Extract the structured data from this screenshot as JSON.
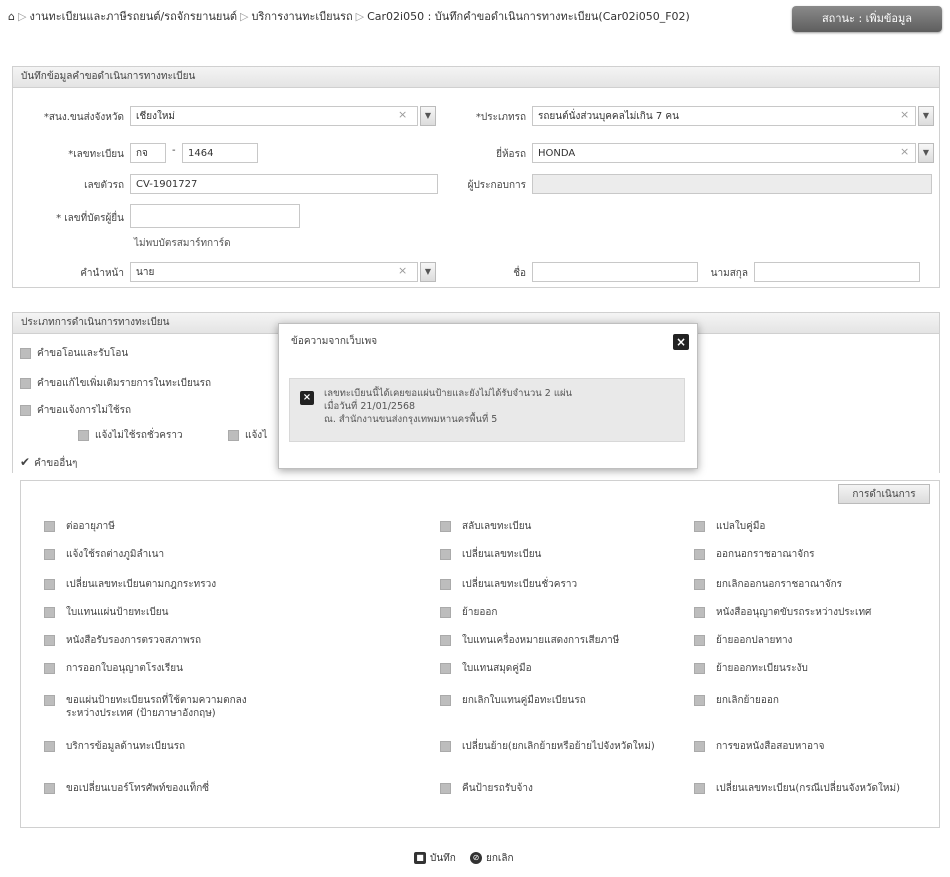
{
  "breadcrumb": {
    "items": [
      "งานทะเบียนและภาษีรถยนต์/รถจักรยานยนต์",
      "บริการงานทะเบียนรถ",
      "Car02i050 : บันทึกคำขอดำเนินการทางทะเบียน(Car02i050_F02)"
    ]
  },
  "status_label": "สถานะ : เพิ่มข้อมูล",
  "section1": {
    "title": "บันทึกข้อมูลคำขอดำเนินการทางทะเบียน",
    "province_label": "*สนง.ขนส่งจังหวัด",
    "province_value": "เชียงใหม่",
    "type_label": "*ประเภทรถ",
    "type_value": "รถยนต์นั่งส่วนบุคคลไม่เกิน 7 คน",
    "plate_label": "*เลขทะเบียน",
    "plate_prefix": "กจ",
    "plate_number": "1464",
    "brand_label": "ยี่ห้อรถ",
    "brand_value": "HONDA",
    "chassis_label": "เลขตัวรถ",
    "chassis_value": "CV-1901727",
    "operator_label": "ผู้ประกอบการ",
    "operator_value": "",
    "idcard_label": "* เลขที่บัตรผู้ยื่น",
    "idcard_value": "",
    "idcard_note": "ไม่พบบัตรสมาร์ทการ์ด",
    "title_label": "คำนำหน้า",
    "title_value": "นาย",
    "name_label": "ชื่อ",
    "name_value": "",
    "surname_label": "นามสกุล",
    "surname_value": ""
  },
  "section2": {
    "title": "ประเภทการดำเนินการทางทะเบียน",
    "options": [
      {
        "label": "คำขอโอนและรับโอน",
        "checked": false
      },
      {
        "label": "คำขอแก้ไขเพิ่มเติมรายการในทะเบียนรถ",
        "checked": false
      },
      {
        "label": "คำขอแจ้งการไม่ใช้รถ",
        "checked": false
      }
    ],
    "suboptions": [
      "แจ้งไม่ใช้รถชั่วคราว",
      "แจ้งไ"
    ],
    "other_label": "คำขออื่นๆ",
    "other_checked": true
  },
  "modal": {
    "title": "ข้อความจากเว็บเพจ",
    "message_lines": [
      "เลขทะเบียนนี้ได้เคยขอแผ่นป้ายและยังไม่ได้รับจำนวน 2 แผ่น",
      "เมื่อวันที่ 21/01/2568",
      "ณ. สำนักงานขนส่งกรุงเทพมหานครพื้นที่ 5"
    ]
  },
  "actions_button": "การดำเนินการ",
  "grid": [
    [
      "ต่ออายุภาษี",
      "สลับเลขทะเบียน",
      "แปลใบคู่มือ"
    ],
    [
      "แจ้งใช้รถต่างภูมิลำเนา",
      "เปลี่ยนเลขทะเบียน",
      "ออกนอกราชอาณาจักร"
    ],
    [
      "เปลี่ยนเลขทะเบียนตามกฎกระทรวง",
      "เปลี่ยนเลขทะเบียนชั่วคราว",
      "ยกเลิกออกนอกราชอาณาจักร"
    ],
    [
      "ใบแทนแผ่นป้ายทะเบียน",
      "ย้ายออก",
      "หนังสืออนุญาตขับรถระหว่างประเทศ"
    ],
    [
      "หนังสือรับรองการตรวจสภาพรถ",
      "ใบแทนเครื่องหมายแสดงการเสียภาษี",
      "ย้ายออกปลายทาง"
    ],
    [
      "การออกใบอนุญาตโรงเรียน",
      "ใบแทนสมุดคู่มือ",
      "ย้ายออกทะเบียนระงับ"
    ],
    [
      "ขอแผ่นป้ายทะเบียนรถที่ใช้ตามความตกลงระหว่างประเทศ (ป้ายภาษาอังกฤษ)",
      "ยกเลิกใบแทนคู่มือทะเบียนรถ",
      "ยกเลิกย้ายออก"
    ],
    [
      "บริการข้อมูลด้านทะเบียนรถ",
      "เปลี่ยนย้าย(ยกเลิกย้ายหรือย้ายไปจังหวัดใหม่)",
      "การขอหนังสือสอบหาอาจ"
    ],
    [
      "ขอเปลี่ยนเบอร์โทรศัพท์ของแท็กซี่",
      "คืนป้ายรถรับจ้าง",
      "เปลี่ยนเลขทะเบียน(กรณีเปลี่ยนจังหวัดใหม่)"
    ]
  ],
  "footer": {
    "save_label": "บันทึก",
    "cancel_label": "ยกเลิก"
  }
}
